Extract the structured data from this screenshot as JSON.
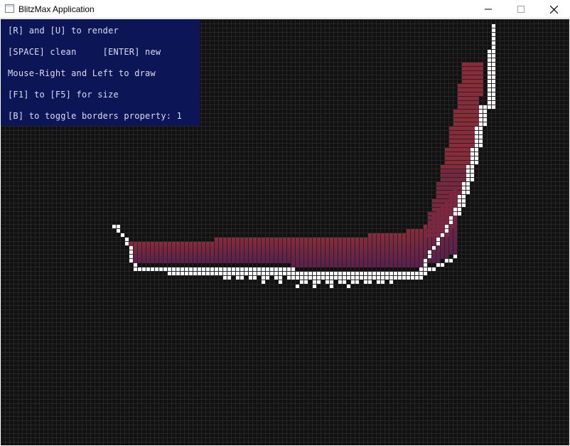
{
  "window": {
    "title": "BlitzMax Application",
    "controls": {
      "minimize_icon": "minimize-icon",
      "maximize_icon": "maximize-icon",
      "close_icon": "close-icon"
    }
  },
  "help": {
    "lines": [
      "[R] and [U] to render",
      "[SPACE] clean     [ENTER] new",
      "Mouse-Right and Left to draw",
      "[F1] to [F5] for size",
      "[B] to toggle borders property: 1"
    ]
  },
  "colors": {
    "background": "#111111",
    "grid": "#262626",
    "panel": "#0c1556",
    "panel_text": "#dcdcf0",
    "border_cells": "#ffffff",
    "fill_top": "#8a2b3a",
    "fill_bottom": "#5a1f4e"
  }
}
